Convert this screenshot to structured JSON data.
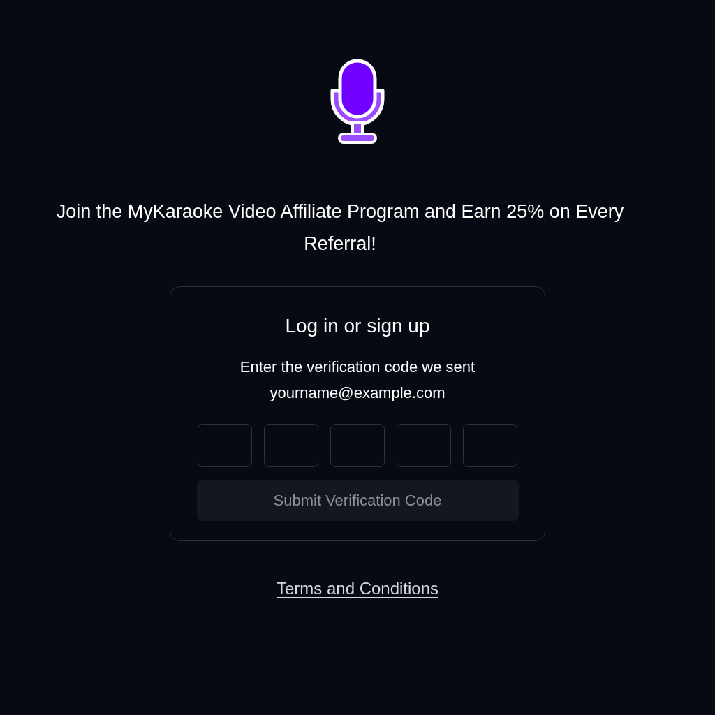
{
  "headline": "Join the MyKaraoke Video Affiliate Program and Earn 25% on Every Referral!",
  "card": {
    "title": "Log in or sign up",
    "instruction": "Enter the verification code we sent",
    "email": "yourname@example.com",
    "code_fields": [
      {
        "filled": false
      },
      {
        "filled": false
      },
      {
        "filled": false
      },
      {
        "filled": false
      },
      {
        "filled": false
      }
    ],
    "submit_button": {
      "label": "Submit Verification Code",
      "disabled": true
    }
  },
  "footer_link": "Terms and Conditions"
}
